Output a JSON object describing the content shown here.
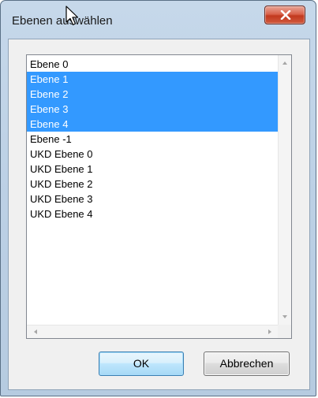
{
  "window": {
    "title": "Ebenen auswählen"
  },
  "list": {
    "items": [
      {
        "label": "Ebene 0",
        "selected": false
      },
      {
        "label": "Ebene 1",
        "selected": true
      },
      {
        "label": "Ebene 2",
        "selected": true
      },
      {
        "label": "Ebene 3",
        "selected": true
      },
      {
        "label": "Ebene 4",
        "selected": true
      },
      {
        "label": "Ebene -1",
        "selected": false
      },
      {
        "label": "UKD Ebene 0",
        "selected": false
      },
      {
        "label": "UKD Ebene 1",
        "selected": false
      },
      {
        "label": "UKD Ebene 2",
        "selected": false
      },
      {
        "label": "UKD Ebene 3",
        "selected": false
      },
      {
        "label": "UKD Ebene 4",
        "selected": false
      }
    ]
  },
  "buttons": {
    "ok_label": "OK",
    "cancel_label": "Abbrechen"
  },
  "colors": {
    "selection": "#3399ff",
    "close_button": "#c2391f",
    "frame": "#bcd0e5"
  },
  "icons": {
    "close": "close-icon",
    "cursor": "mouse-cursor-icon"
  }
}
